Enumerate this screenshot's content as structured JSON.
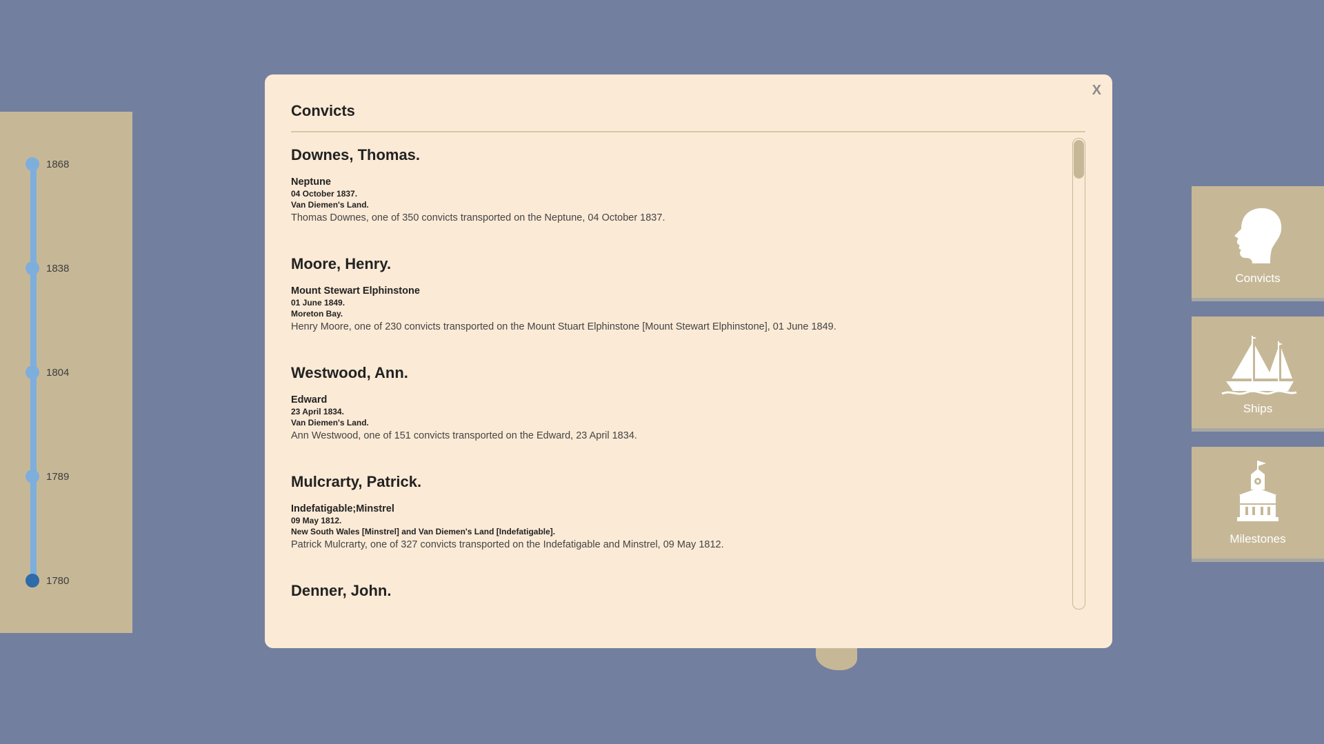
{
  "timeline": {
    "years": [
      "1868",
      "1838",
      "1804",
      "1789",
      "1780"
    ],
    "active_year": "1780"
  },
  "modal": {
    "title": "Convicts",
    "close_label": "X",
    "entries": [
      {
        "name": "Downes, Thomas.",
        "ship": "Neptune",
        "date": "04 October 1837.",
        "destination": "Van Diemen's Land.",
        "description": "Thomas Downes, one of 350 convicts transported on the Neptune, 04 October 1837."
      },
      {
        "name": "Moore, Henry.",
        "ship": "Mount Stewart Elphinstone",
        "date": "01 June 1849.",
        "destination": "Moreton Bay.",
        "description": "Henry Moore, one of 230 convicts transported on the Mount Stuart Elphinstone [Mount Stewart Elphinstone], 01 June 1849."
      },
      {
        "name": "Westwood, Ann.",
        "ship": "Edward",
        "date": "23 April 1834.",
        "destination": "Van Diemen's Land.",
        "description": "Ann Westwood, one of 151 convicts transported on the Edward, 23 April 1834."
      },
      {
        "name": "Mulcrarty, Patrick.",
        "ship": "Indefatigable;Minstrel",
        "date": "09 May 1812.",
        "destination": "New South Wales [Minstrel] and Van Diemen's Land [Indefatigable].",
        "description": "Patrick Mulcrarty, one of 327 convicts transported on the Indefatigable and Minstrel, 09 May 1812."
      },
      {
        "name": "Denner, John.",
        "ship": "",
        "date": "",
        "destination": "",
        "description": ""
      }
    ]
  },
  "nav": {
    "convicts_label": "Convicts",
    "ships_label": "Ships",
    "milestones_label": "Milestones"
  },
  "colors": {
    "background": "#737f9e",
    "panel": "#c6b897",
    "modal": "#fbead6",
    "timeline_track": "#7eaedc",
    "timeline_active": "#2f6ba8"
  }
}
